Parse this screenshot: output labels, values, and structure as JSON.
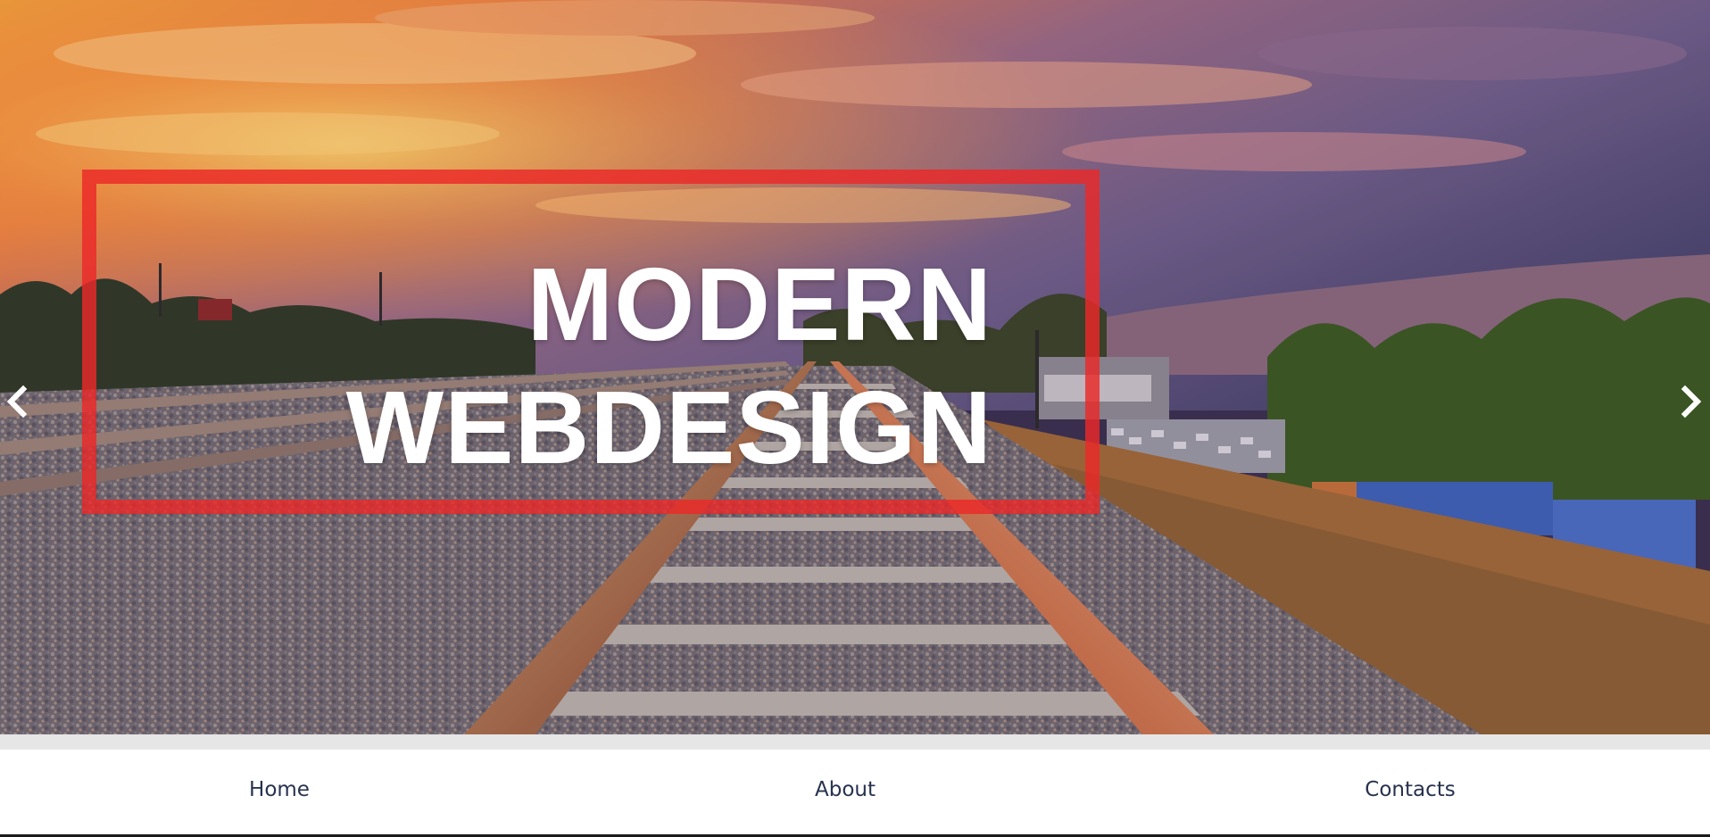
{
  "hero": {
    "headline_line1": "MODERN",
    "headline_line2": "WEBDESIGN",
    "frame_color": "#ec2828",
    "prev_icon": "chevron-left-icon",
    "next_icon": "chevron-right-icon"
  },
  "nav": {
    "items": [
      {
        "label": "Home"
      },
      {
        "label": "About"
      },
      {
        "label": "Contacts"
      }
    ],
    "text_color": "#27324f"
  }
}
